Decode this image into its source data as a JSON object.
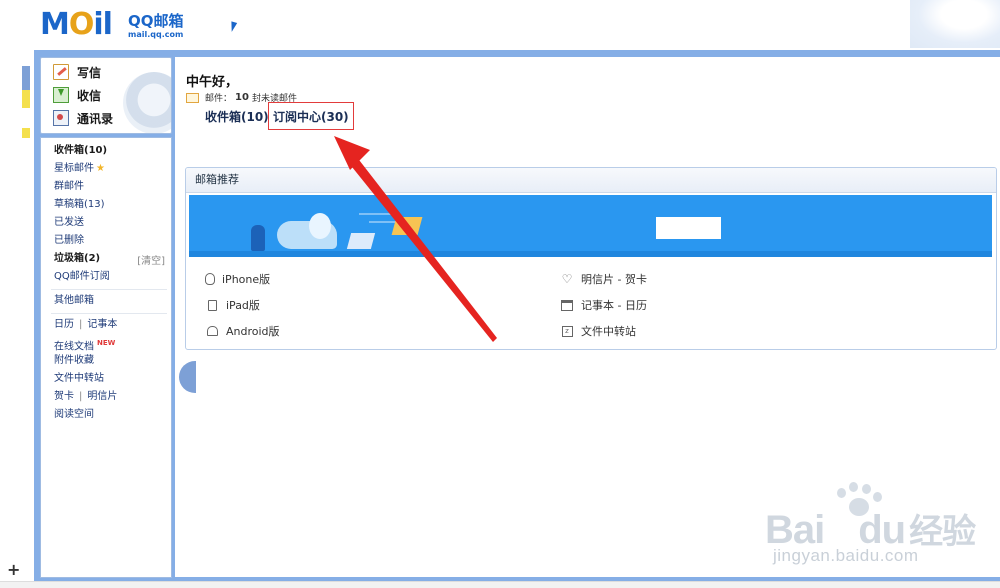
{
  "header": {
    "logo_word_m": "M",
    "logo_word_o": "O",
    "logo_word_il": "il",
    "logo_title": "QQ邮箱",
    "logo_sub": "mail.qq.com"
  },
  "quick_nav": [
    {
      "label": "写信",
      "icon": "pencil-icon"
    },
    {
      "label": "收信",
      "icon": "inbox-download-icon"
    },
    {
      "label": "通讯录",
      "icon": "address-book-icon"
    }
  ],
  "folders": {
    "inbox": "收件箱(10)",
    "starred": "星标邮件",
    "group": "群邮件",
    "drafts": "草稿箱(13)",
    "sent": "已发送",
    "deleted": "已删除",
    "spam": "垃圾箱(2)",
    "spam_clear": "[清空]",
    "subscriptions": "QQ邮件订阅",
    "other_mailbox": "其他邮箱"
  },
  "tools": {
    "calendar": "日历",
    "notes": "记事本",
    "online_docs": "在线文档",
    "new_badge": "NEW",
    "attachments": "附件收藏",
    "file_transfer": "文件中转站",
    "greeting_cards": "贺卡",
    "postcards": "明信片",
    "reading_space": "阅读空间"
  },
  "main": {
    "greeting": "中午好，",
    "mail_label": "邮件：",
    "unread_count": "10",
    "unread_suffix": "封未读邮件",
    "tabs": [
      {
        "label": "收件箱(10)"
      },
      {
        "label": "订阅中心(30)"
      }
    ]
  },
  "recommend": {
    "title": "邮箱推荐",
    "left_items": [
      {
        "label": "iPhone版",
        "icon": "apple-icon"
      },
      {
        "label": "iPad版",
        "icon": "tablet-icon"
      },
      {
        "label": "Android版",
        "icon": "android-icon"
      }
    ],
    "right_items": [
      {
        "label": "明信片 - 贺卡",
        "icon": "heart-icon"
      },
      {
        "label": "记事本 - 日历",
        "icon": "calendar-icon"
      },
      {
        "label": "文件中转站",
        "icon": "file-transfer-icon"
      }
    ]
  },
  "watermark": {
    "brand": "Bai",
    "brand2": "du",
    "brand_cn": "经验",
    "url": "jingyan.baidu.com"
  },
  "colors": {
    "frame_blue": "#85aee6",
    "banner_blue": "#2a97f0",
    "highlight_red": "#e23b3b",
    "arrow_red": "#e52420",
    "brand_blue": "#1b66c9"
  }
}
